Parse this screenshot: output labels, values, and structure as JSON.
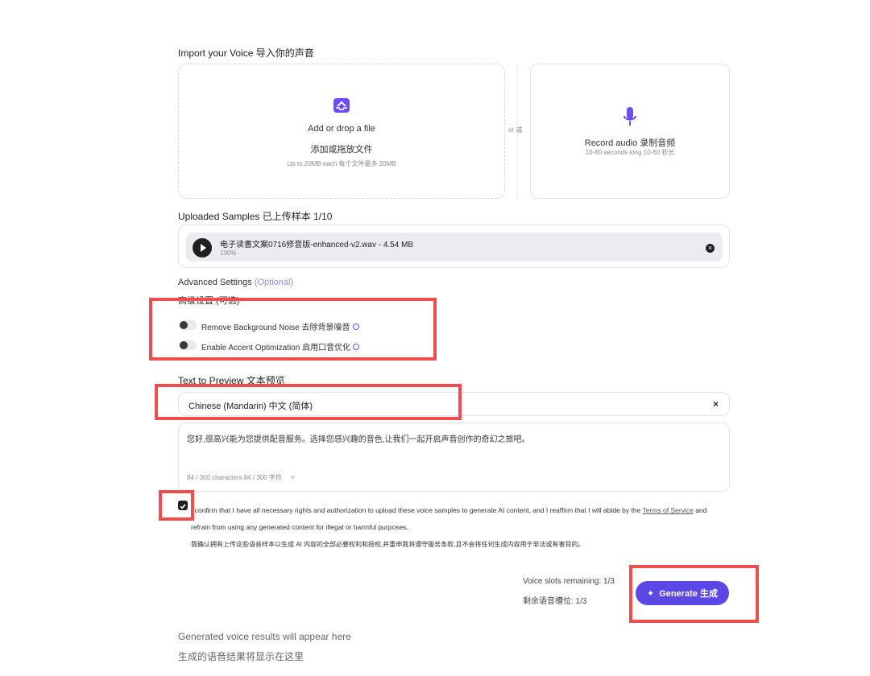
{
  "import": {
    "title": "Import your Voice  导入你的声音",
    "upload_title": "Add or drop a file",
    "upload_title_cn": "添加或拖放文件",
    "upload_hint": "Up to 20MB each  每个文件最多 20MB",
    "or_label": "or 或",
    "record_title": "Record audio  录制音频",
    "record_hint": "10-60 seconds long  10-60 秒长"
  },
  "samples": {
    "title": "Uploaded Samples  已上传样本  1/10",
    "file_name": "电子读書文案0716修音版-enhanced-v2.wav - 4.54 MB",
    "progress": "100%"
  },
  "advanced": {
    "title": "Advanced Settings",
    "optional": "(Optional)",
    "title_cn": "高级设置 (可选)",
    "toggles": [
      {
        "label": "Remove Background Noise   去除背景噪音",
        "on": false
      },
      {
        "label": "Enable Accent Optimization   启用口音优化",
        "on": false
      }
    ]
  },
  "preview": {
    "title": "Text to Preview  文本预览",
    "language": "Chinese (Mandarin)  中文 (简体)",
    "clear": "×",
    "text": "您好,很高兴能为您提供配音服务。选择您感兴趣的音色,让我们一起开启声音创作的奇幻之旅吧。",
    "char_count": "84 / 300 characters  84 / 300 字符"
  },
  "consent": {
    "checked": true,
    "text_en_1": "I confirm that I have all necessary rights and authorization to upload these voice samples to generate AI content, and I reaffirm that I will abide by the",
    "tos_link": "Terms of Service",
    "text_en_2": " and refrain from using any generated content for illegal or harmful purposes.",
    "text_cn": "我确认拥有上传这些语音样本以生成 AI 内容的全部必要权利和授权,并重申我将遵守服务条款,且不会将任何生成内容用于非法或有害目的。"
  },
  "slots": {
    "line_en": "Voice slots remaining: 1/3",
    "line_cn": "剩余语音槽位: 1/3"
  },
  "generate": {
    "label": "Generate  生成"
  },
  "results": {
    "line_en": "Generated voice results will appear here",
    "line_cn": "生成的语音结果将显示在这里"
  },
  "colors": {
    "accent": "#5b46e6",
    "highlight": "#ee4e4e"
  }
}
